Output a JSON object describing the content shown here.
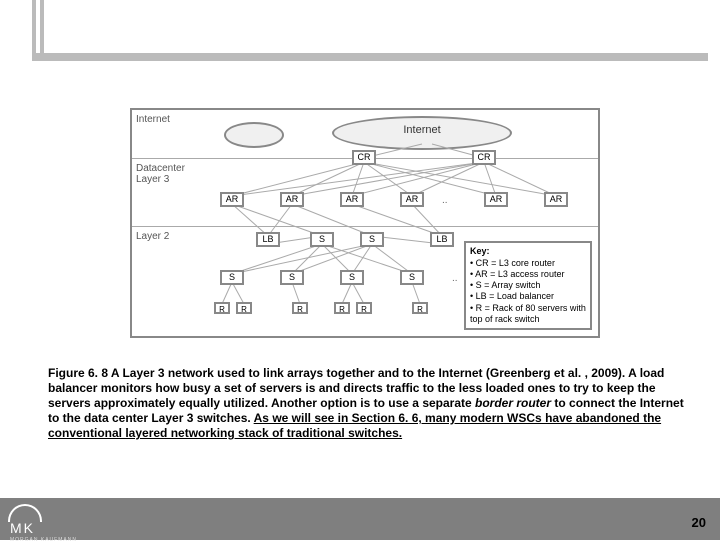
{
  "figure": {
    "sections": {
      "internet": "Internet",
      "dc": "Datacenter\nLayer 3",
      "l2": "Layer 2"
    },
    "cloud_internet": "Internet",
    "nodes": {
      "cr": "CR",
      "ar": "AR",
      "lb": "LB",
      "s": "S",
      "r": "R"
    },
    "dots": "..",
    "key": {
      "title": "Key:",
      "lines": [
        "• CR = L3 core router",
        "• AR = L3 access router",
        "• S = Array switch",
        "• LB = Load balancer",
        "• R = Rack of 80 servers with top of rack switch"
      ]
    }
  },
  "caption": {
    "lead": "Figure 6. 8 A Layer 3 network used to link arrays together and to the Internet (Greenberg et al. , 2009). ",
    "body1": "A load balancer monitors how busy a set of servers is and directs traffic to the less loaded ones to try to keep the servers approximately equally utilized. Another option is to use a separate ",
    "italic": "border router",
    "body2": " to connect the Internet to the data center Layer 3 switches. ",
    "underline": "As we will see in Section 6. 6, many modern WSCs have abandoned the conventional layered networking stack of traditional switches."
  },
  "footer": {
    "logo": "MK",
    "publisher": "MORGAN KAUFMANN",
    "page": "20"
  }
}
